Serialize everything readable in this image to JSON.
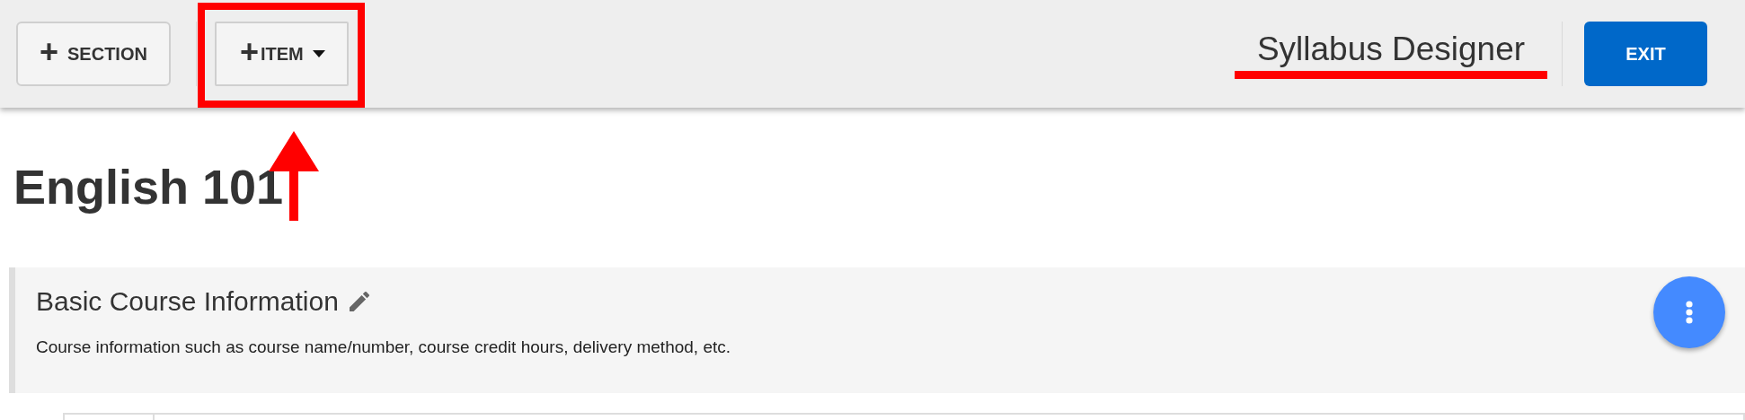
{
  "toolbar": {
    "buttons": [
      {
        "kind": "plain",
        "icon": "+",
        "label": "SECTION"
      },
      {
        "kind": "dropdown",
        "icon": "+",
        "label": "ITEM",
        "highlighted": true
      }
    ],
    "app_title": "Syllabus Designer",
    "exit_button": "EXIT"
  },
  "page": {
    "title": "English 101"
  },
  "sections": [
    {
      "title": "Basic Course Information",
      "description": "Course information such as course name/number, course credit hours, delivery method, etc."
    }
  ]
}
